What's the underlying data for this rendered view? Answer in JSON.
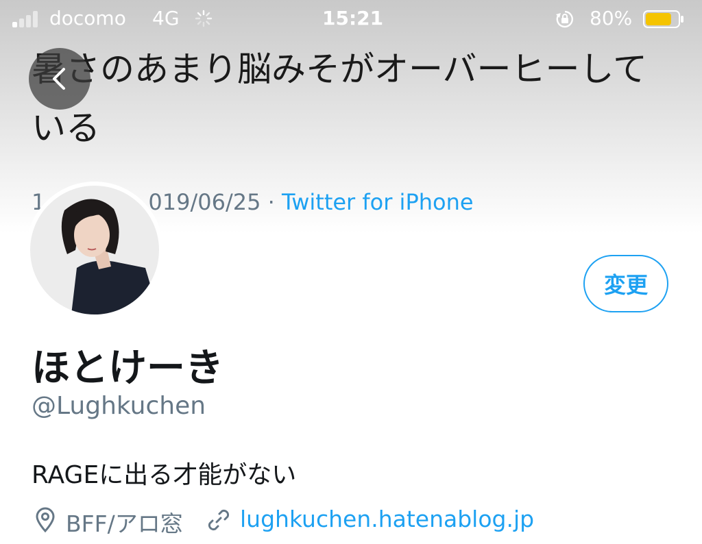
{
  "status_bar": {
    "carrier": "docomo",
    "network": "4G",
    "time": "15:21",
    "battery_percent": "80%",
    "battery_level": 0.8,
    "battery_color": "#f5c400"
  },
  "tweet": {
    "text": "暑さのあまり脳みそがオーバーヒーしている",
    "meta_prefix": "1",
    "meta_date": "019/06/25 · ",
    "source": "Twitter for iPhone"
  },
  "profile": {
    "change_button_label": "変更",
    "display_name": "ほとけーき",
    "handle": "@Lughkuchen",
    "bio": "RAGEに出る才能がない",
    "location": "BFF/アロ窓",
    "website": "lughkuchen.hatenablog.jp"
  },
  "colors": {
    "accent": "#1da1f2",
    "secondary_text": "#657786"
  },
  "icons": {
    "back": "chevron-left-icon",
    "location": "map-pin-icon",
    "link": "link-icon",
    "orientation_lock": "rotation-lock-icon"
  }
}
